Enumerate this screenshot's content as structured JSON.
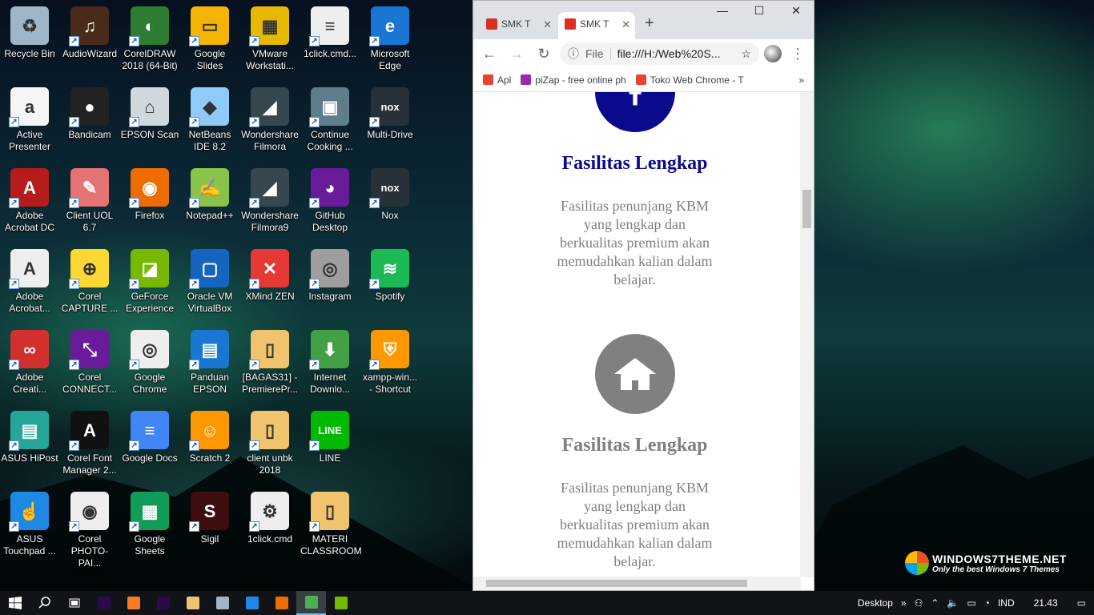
{
  "desktop": {
    "icons": [
      {
        "label": "Recycle Bin",
        "color": "#9fb6c8",
        "glyph": "♻",
        "col": 0,
        "row": 0
      },
      {
        "label": "AudioWizard",
        "color": "#4a2a1a",
        "glyph": "♫",
        "col": 1,
        "row": 0
      },
      {
        "label": "CorelDRAW 2018 (64-Bit)",
        "color": "#2e7d32",
        "glyph": "◐",
        "col": 2,
        "row": 0
      },
      {
        "label": "Google Slides",
        "color": "#f4b400",
        "glyph": "▭",
        "col": 3,
        "row": 0
      },
      {
        "label": "VMware Workstati...",
        "color": "#e6b800",
        "glyph": "▦",
        "col": 4,
        "row": 0
      },
      {
        "label": "1click.cmd...",
        "color": "#eeeeee",
        "glyph": "≡",
        "col": 5,
        "row": 0
      },
      {
        "label": "Microsoft Edge",
        "color": "#1976d2",
        "glyph": "e",
        "col": 6,
        "row": 0
      },
      {
        "label": "Active Presenter",
        "color": "#f5f5f5",
        "glyph": "a",
        "col": 0,
        "row": 1
      },
      {
        "label": "Bandicam",
        "color": "#222222",
        "glyph": "●",
        "col": 1,
        "row": 1
      },
      {
        "label": "EPSON Scan",
        "color": "#cfd8dc",
        "glyph": "⌂",
        "col": 2,
        "row": 1
      },
      {
        "label": "NetBeans IDE 8.2",
        "color": "#90caf9",
        "glyph": "◆",
        "col": 3,
        "row": 1
      },
      {
        "label": "Wondershare Filmora",
        "color": "#37474f",
        "glyph": "◢",
        "col": 4,
        "row": 1
      },
      {
        "label": "Continue Cooking ...",
        "color": "#607d8b",
        "glyph": "▣",
        "col": 5,
        "row": 1
      },
      {
        "label": "Multi-Drive",
        "color": "#263238",
        "glyph": "nox",
        "col": 6,
        "row": 1
      },
      {
        "label": "Adobe Acrobat DC",
        "color": "#b71c1c",
        "glyph": "A",
        "col": 0,
        "row": 2
      },
      {
        "label": "Client UOL 6.7",
        "color": "#e57373",
        "glyph": "✎",
        "col": 1,
        "row": 2
      },
      {
        "label": "Firefox",
        "color": "#ef6c00",
        "glyph": "◉",
        "col": 2,
        "row": 2
      },
      {
        "label": "Notepad++",
        "color": "#8bc34a",
        "glyph": "✍",
        "col": 3,
        "row": 2
      },
      {
        "label": "Wondershare Filmora9",
        "color": "#37474f",
        "glyph": "◢",
        "col": 4,
        "row": 2
      },
      {
        "label": "GitHub Desktop",
        "color": "#6a1b9a",
        "glyph": "◕",
        "col": 5,
        "row": 2
      },
      {
        "label": "Nox",
        "color": "#263238",
        "glyph": "nox",
        "col": 6,
        "row": 2
      },
      {
        "label": "Adobe Acrobat...",
        "color": "#eeeeee",
        "glyph": "A",
        "col": 0,
        "row": 3
      },
      {
        "label": "Corel CAPTURE ...",
        "color": "#fdd835",
        "glyph": "⊕",
        "col": 1,
        "row": 3
      },
      {
        "label": "GeForce Experience",
        "color": "#76b900",
        "glyph": "◪",
        "col": 2,
        "row": 3
      },
      {
        "label": "Oracle VM VirtualBox",
        "color": "#1565c0",
        "glyph": "▢",
        "col": 3,
        "row": 3
      },
      {
        "label": "XMind ZEN",
        "color": "#e53935",
        "glyph": "✕",
        "col": 4,
        "row": 3
      },
      {
        "label": "Instagram",
        "color": "#9e9e9e",
        "glyph": "◎",
        "col": 5,
        "row": 3
      },
      {
        "label": "Spotify",
        "color": "#1db954",
        "glyph": "≋",
        "col": 6,
        "row": 3
      },
      {
        "label": "Adobe Creati...",
        "color": "#d32f2f",
        "glyph": "∞",
        "col": 0,
        "row": 4
      },
      {
        "label": "Corel CONNECT...",
        "color": "#6a1b9a",
        "glyph": "⤡",
        "col": 1,
        "row": 4
      },
      {
        "label": "Google Chrome",
        "color": "#eeeeee",
        "glyph": "◎",
        "col": 2,
        "row": 4
      },
      {
        "label": "Panduan EPSON",
        "color": "#1976d2",
        "glyph": "▤",
        "col": 3,
        "row": 4
      },
      {
        "label": "[BAGAS31] - PremierePr...",
        "color": "#f0c36d",
        "glyph": "▯",
        "col": 4,
        "row": 4
      },
      {
        "label": "Internet Downlo...",
        "color": "#43a047",
        "glyph": "⬇",
        "col": 5,
        "row": 4
      },
      {
        "label": "xampp-win... - Shortcut",
        "color": "#ff9800",
        "glyph": "⛨",
        "col": 6,
        "row": 4
      },
      {
        "label": "ASUS HiPost",
        "color": "#26a69a",
        "glyph": "▤",
        "col": 0,
        "row": 5
      },
      {
        "label": "Corel Font Manager 2...",
        "color": "#111111",
        "glyph": "A",
        "col": 1,
        "row": 5
      },
      {
        "label": "Google Docs",
        "color": "#4285f4",
        "glyph": "≡",
        "col": 2,
        "row": 5
      },
      {
        "label": "Scratch 2",
        "color": "#ff9800",
        "glyph": "☺",
        "col": 3,
        "row": 5
      },
      {
        "label": "client unbk 2018",
        "color": "#f0c36d",
        "glyph": "▯",
        "col": 4,
        "row": 5
      },
      {
        "label": "LINE",
        "color": "#00b900",
        "glyph": "LINE",
        "col": 5,
        "row": 5
      },
      {
        "label": "ASUS Touchpad ...",
        "color": "#1e88e5",
        "glyph": "☝",
        "col": 0,
        "row": 6
      },
      {
        "label": "Corel PHOTO-PAI...",
        "color": "#eeeeee",
        "glyph": "◉",
        "col": 1,
        "row": 6
      },
      {
        "label": "Google Sheets",
        "color": "#0f9d58",
        "glyph": "▦",
        "col": 2,
        "row": 6
      },
      {
        "label": "Sigil",
        "color": "#3e0d0d",
        "glyph": "S",
        "col": 3,
        "row": 6
      },
      {
        "label": "1click.cmd",
        "color": "#eeeeee",
        "glyph": "⚙",
        "col": 4,
        "row": 6
      },
      {
        "label": "MATERI CLASSROOM",
        "color": "#f0c36d",
        "glyph": "▯",
        "col": 5,
        "row": 6
      }
    ]
  },
  "browser": {
    "tabs": [
      {
        "title": "SMK T",
        "close": "✕"
      },
      {
        "title": "SMK T",
        "close": "✕"
      }
    ],
    "new_tab": "+",
    "window": {
      "minimize": "—",
      "maximize": "☐",
      "close": "✕"
    },
    "nav": {
      "back": "←",
      "forward": "→",
      "reload": "↻",
      "star": "☆",
      "menu": "⋮"
    },
    "address": {
      "scheme": "File",
      "url": "file:///H:/Web%20S..."
    },
    "bookmarks": [
      {
        "label": "Apl",
        "color": "#ea4335"
      },
      {
        "label": "piZap - free online ph",
        "color": "#9c27b0"
      },
      {
        "label": "Toko Web Chrome - T",
        "color": "#ea4335"
      }
    ],
    "bookmarks_more": "»",
    "page": {
      "features": [
        {
          "title": "Fasilitas Lengkap",
          "title_color": "#0a0a8c",
          "circle_color": "#0a0a8c",
          "icon": "facebook-icon",
          "description": "Fasilitas penunjang KBM yang lengkap dan berkualitas premium akan memudahkan kalian dalam belajar."
        },
        {
          "title": "Fasilitas Lengkap",
          "title_color": "#808080",
          "circle_color": "#808080",
          "icon": "home-icon",
          "description": "Fasilitas penunjang KBM yang lengkap dan berkualitas premium akan memudahkan kalian dalam belajar."
        }
      ]
    }
  },
  "watermark": {
    "main": "WINDOWS7THEME.NET",
    "sub": "Only the best Windows 7 Themes"
  },
  "taskbar": {
    "pinned": [
      {
        "name": "premiere-icon",
        "color": "#2a0a4a",
        "active": false
      },
      {
        "name": "xampp-icon",
        "color": "#fb7a24",
        "active": false
      },
      {
        "name": "premiere-icon-2",
        "color": "#2a0a4a",
        "active": false
      },
      {
        "name": "file-explorer-icon",
        "color": "#f0c36d",
        "active": false
      },
      {
        "name": "virtualbox-icon",
        "color": "#9fb6c8",
        "active": false
      },
      {
        "name": "vscode-icon",
        "color": "#1e88e5",
        "active": false
      },
      {
        "name": "firefox-icon",
        "color": "#ef6c00",
        "active": false
      },
      {
        "name": "chrome-icon",
        "color": "#4caf50",
        "active": true
      },
      {
        "name": "geforce-icon",
        "color": "#76b900",
        "active": false
      }
    ],
    "desktop_label": "Desktop",
    "more": "»",
    "language": "IND",
    "time": "21.43"
  }
}
